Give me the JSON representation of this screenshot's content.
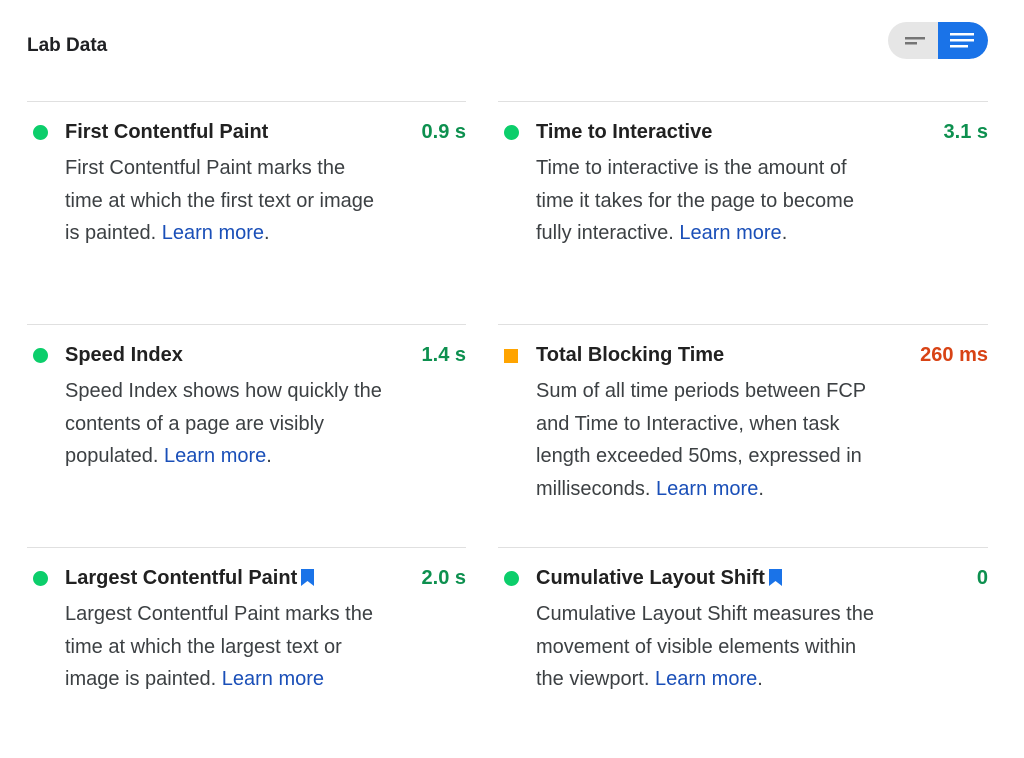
{
  "header": {
    "title": "Lab Data",
    "toggle": {
      "summary_icon": "short-lines-icon",
      "expanded_icon": "long-lines-icon",
      "active": "expanded",
      "active_color": "#1a73e8"
    }
  },
  "metrics": [
    {
      "title": "First Contentful Paint",
      "value": "0.9 s",
      "status": "pass",
      "bookmark": false,
      "desc": "First Contentful Paint marks the time at which the first text or image is painted.",
      "link": "Learn more"
    },
    {
      "title": "Time to Interactive",
      "value": "3.1 s",
      "status": "pass",
      "bookmark": false,
      "desc": "Time to interactive is the amount of time it takes for the page to become fully interactive.",
      "link": "Learn more"
    },
    {
      "title": "Speed Index",
      "value": "1.4 s",
      "status": "pass",
      "bookmark": false,
      "desc": "Speed Index shows how quickly the contents of a page are visibly populated.",
      "link": "Learn more"
    },
    {
      "title": "Total Blocking Time",
      "value": "260 ms",
      "status": "average",
      "bookmark": false,
      "desc": "Sum of all time periods between FCP and Time to Interactive, when task length exceeded 50ms, expressed in milliseconds.",
      "link": "Learn more"
    },
    {
      "title": "Largest Contentful Paint",
      "value": "2.0 s",
      "status": "pass",
      "bookmark": true,
      "desc": "Largest Contentful Paint marks the time at which the largest text or image is painted.",
      "link": "Learn more"
    },
    {
      "title": "Cumulative Layout Shift",
      "value": "0",
      "status": "pass",
      "bookmark": true,
      "desc": "Cumulative Layout Shift measures the movement of visible elements within the viewport.",
      "link": "Learn more"
    }
  ],
  "colors": {
    "pass": "#0cce6b",
    "average": "#ffa400",
    "pass_text": "#0d904f",
    "average_text": "#d84315",
    "link": "#1a4fb8",
    "bookmark": "#1a73e8"
  }
}
